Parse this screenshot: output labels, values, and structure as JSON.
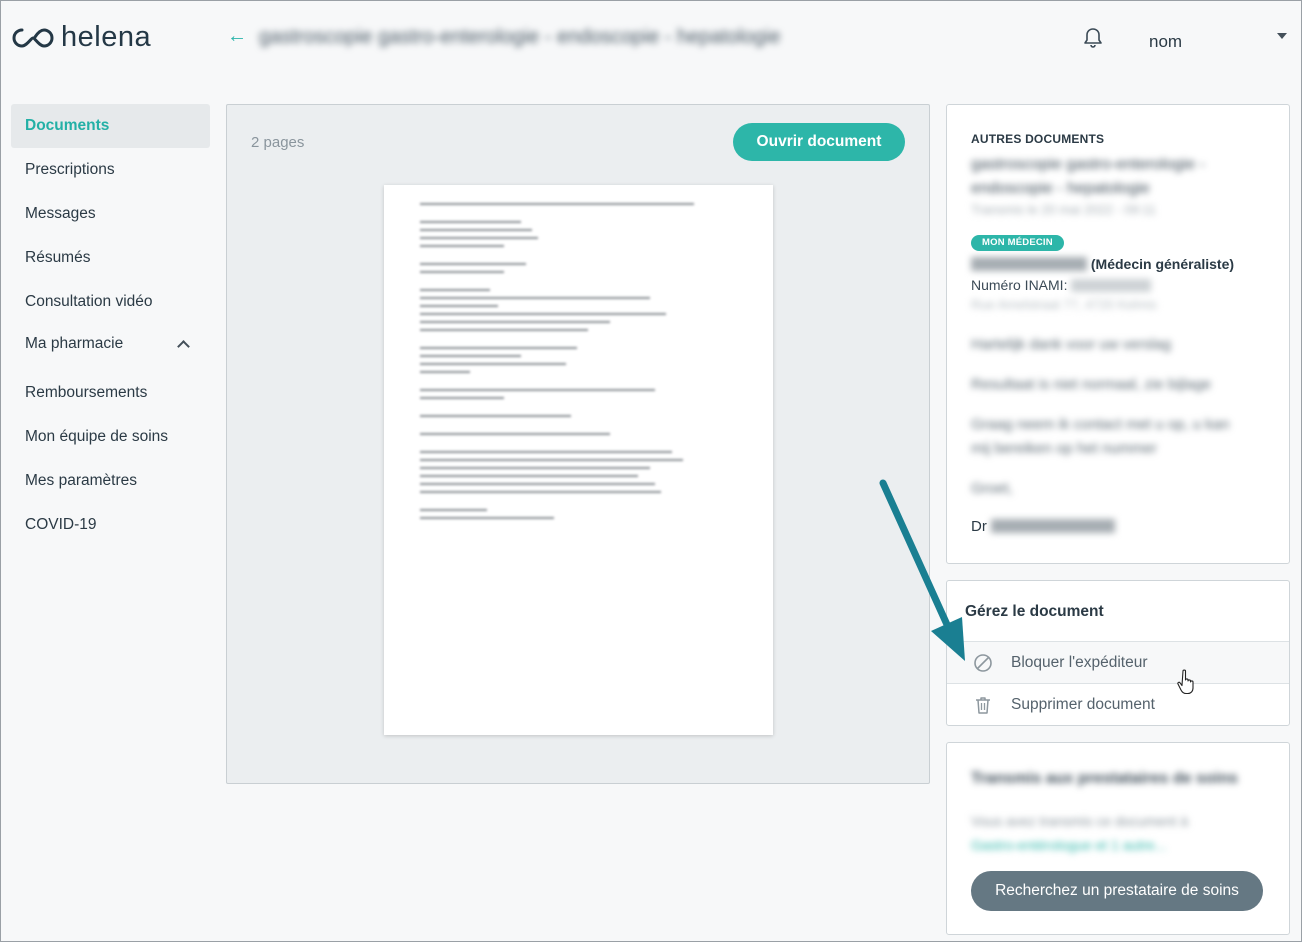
{
  "header": {
    "logo_text": "helena",
    "page_title": "gastroscopie gastro-enterologie - endoscopie - hepatologie",
    "user_name": "nom"
  },
  "sidebar": {
    "items": [
      {
        "label": "Documents"
      },
      {
        "label": "Prescriptions"
      },
      {
        "label": "Messages"
      },
      {
        "label": "Résumés"
      },
      {
        "label": "Consultation vidéo"
      },
      {
        "label": "Ma pharmacie"
      },
      {
        "label": "Remboursements"
      },
      {
        "label": "Mon équipe de soins"
      },
      {
        "label": "Mes paramètres"
      },
      {
        "label": "COVID-19"
      }
    ]
  },
  "viewer": {
    "page_count": "2 pages",
    "open_label": "Ouvrir document"
  },
  "other_documents": {
    "heading": "AUTRES DOCUMENTS",
    "title": "gastroscopie gastro-enterologie - endoscopie - hepatologie",
    "date": "Transmis le 20 mai 2022 - 09:11",
    "badge": "MON MÉDECIN",
    "doctor_role": "(Médecin généraliste)",
    "inami_label": "Numéro INAMI:",
    "address": "Rue Amelstraat 77, 4720 Kelmis",
    "messages": [
      "Hartelijk dank voor uw verslag",
      "Resultaat is niet normaal, zie bijlage",
      "Graag neem ik contact met u op, u kan mij bereiken op het nummer",
      "Groet,"
    ],
    "sign_prefix": "Dr"
  },
  "manage": {
    "title": "Gérez le document",
    "block_label": "Bloquer l'expéditeur",
    "delete_label": "Supprimer document"
  },
  "transmit": {
    "title": "Transmis aux prestataires de soins",
    "text": "Vous avez transmis ce document à",
    "link": "Gastro-entérologue et 1 autre...",
    "button_label": "Recherchez un prestataire de soins"
  },
  "colors": {
    "accent": "#2db6a9",
    "annotation_arrow": "#1a7f92",
    "secondary_button": "#657883"
  }
}
